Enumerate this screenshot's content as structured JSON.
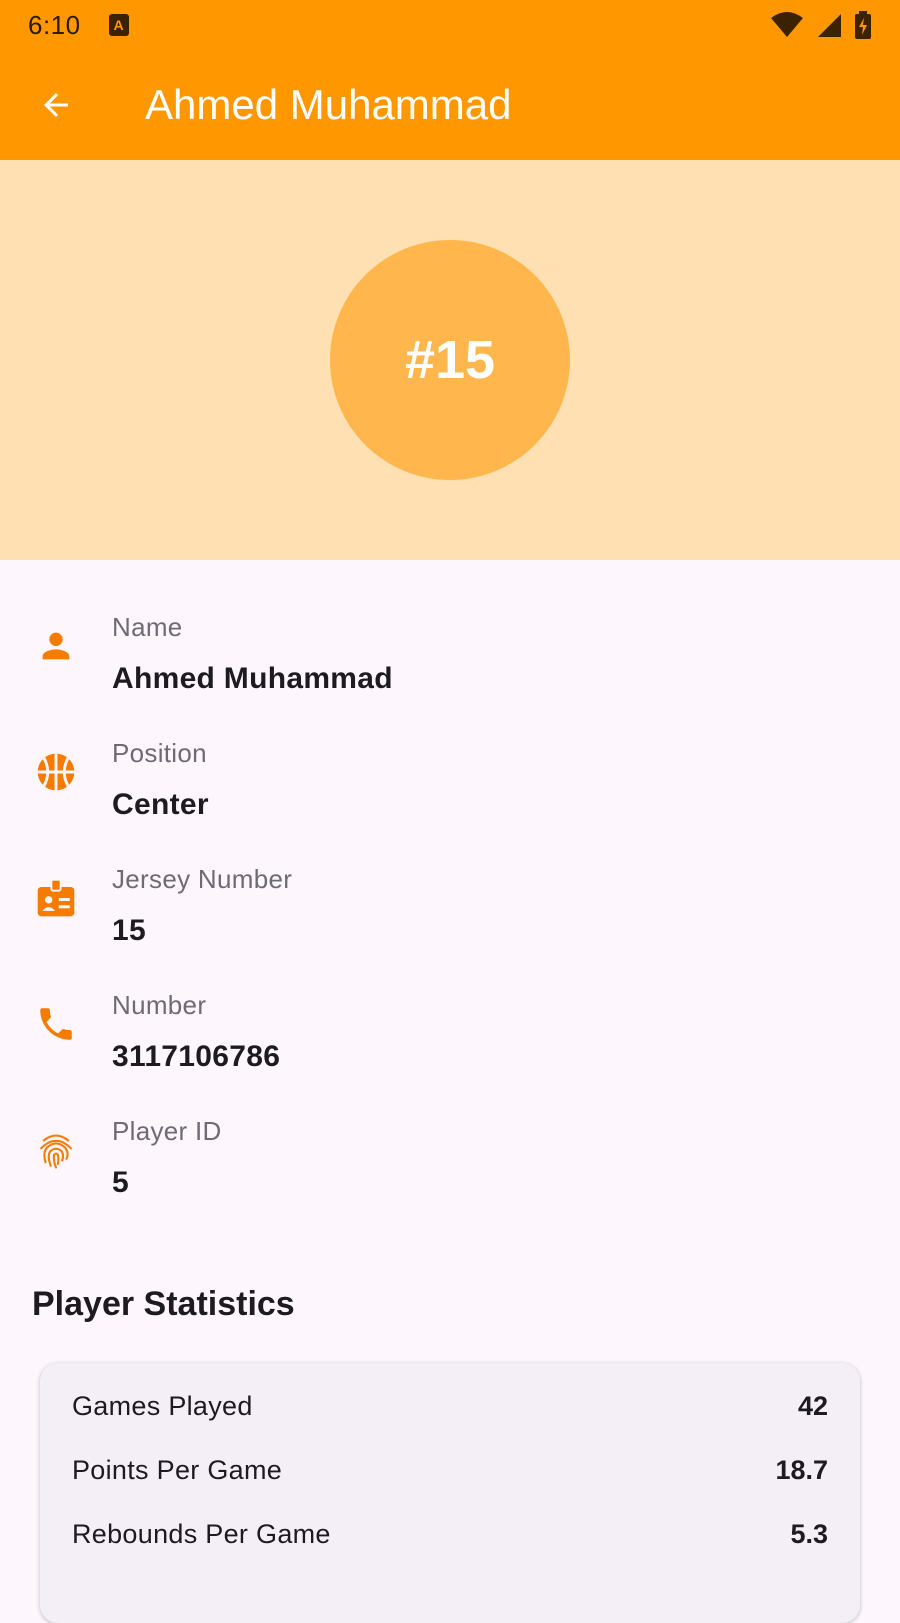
{
  "status_bar": {
    "time": "6:10",
    "app_icon_letter": "A"
  },
  "app_bar": {
    "title": "Ahmed Muhammad"
  },
  "hero": {
    "avatar_text": "#15"
  },
  "info": [
    {
      "icon": "person-icon",
      "label": "Name",
      "value": "Ahmed Muhammad"
    },
    {
      "icon": "basketball-icon",
      "label": "Position",
      "value": "Center"
    },
    {
      "icon": "badge-icon",
      "label": "Jersey Number",
      "value": "15"
    },
    {
      "icon": "phone-icon",
      "label": "Number",
      "value": "3117106786"
    },
    {
      "icon": "fingerprint-icon",
      "label": "Player ID",
      "value": "5"
    }
  ],
  "stats": {
    "heading": "Player Statistics",
    "rows": [
      {
        "label": "Games Played",
        "value": "42"
      },
      {
        "label": "Points Per Game",
        "value": "18.7"
      },
      {
        "label": "Rebounds Per Game",
        "value": "5.3"
      }
    ]
  },
  "colors": {
    "primary": "#ff9800",
    "hero_bg": "#ffe0b2",
    "avatar_bg": "#ffb74d",
    "icon": "#f57c00"
  }
}
